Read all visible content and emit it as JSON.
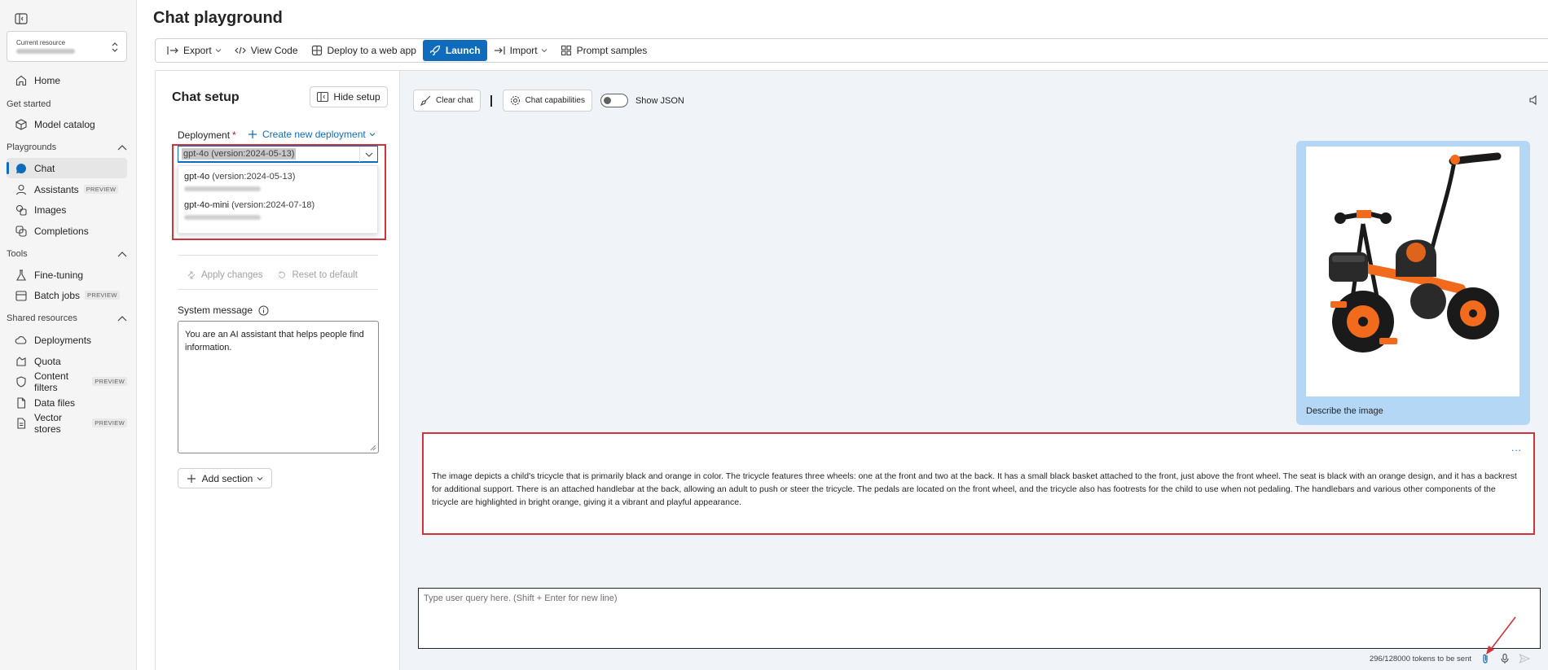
{
  "sidebar": {
    "current_resource_label": "Current resource",
    "items": {
      "home": "Home",
      "get_started_header": "Get started",
      "model_catalog": "Model catalog",
      "playgrounds_header": "Playgrounds",
      "chat": "Chat",
      "assistants": "Assistants",
      "images": "Images",
      "completions": "Completions",
      "tools_header": "Tools",
      "fine_tuning": "Fine-tuning",
      "batch_jobs": "Batch jobs",
      "shared_resources_header": "Shared resources",
      "deployments": "Deployments",
      "quota": "Quota",
      "content_filters": "Content filters",
      "data_files": "Data files",
      "vector_stores": "Vector stores"
    },
    "preview_badge": "PREVIEW"
  },
  "page": {
    "title": "Chat playground"
  },
  "toolbar": {
    "export": "Export",
    "view_code": "View Code",
    "deploy": "Deploy to a web app",
    "launch": "Launch",
    "import": "Import",
    "prompt_samples": "Prompt samples"
  },
  "setup": {
    "title": "Chat setup",
    "hide_setup": "Hide setup",
    "deployment_label": "Deployment",
    "required_mark": "*",
    "create_new_deployment": "Create new deployment",
    "selected_deployment": "gpt-4o (version:2024-05-13)",
    "options": [
      {
        "name": "gpt-4o",
        "version": "(version:2024-05-13)"
      },
      {
        "name": "gpt-4o-mini",
        "version": "(version:2024-07-18)"
      }
    ],
    "apply_changes": "Apply changes",
    "reset_default": "Reset to default",
    "system_message_label": "System message",
    "system_message_value": "You are an AI assistant that helps people find information.",
    "add_section": "Add section"
  },
  "chat": {
    "clear_chat": "Clear chat",
    "chat_capabilities": "Chat capabilities",
    "show_json": "Show JSON",
    "user_message": "Describe the image",
    "assistant_message": "The image depicts a child's tricycle that is primarily black and orange in color. The tricycle features three wheels: one at the front and two at the back. It has a small black basket attached to the front, just above the front wheel. The seat is black with an orange design, and it has a backrest for additional support. There is an attached handlebar at the back, allowing an adult to push or steer the tricycle. The pedals are located on the front wheel, and the tricycle also has footrests for the child to use when not pedaling. The handlebars and various other components of the tricycle are highlighted in bright orange, giving it a vibrant and playful appearance.",
    "more_label": "...",
    "input_placeholder": "Type user query here. (Shift + Enter for new line)",
    "token_count": "296/128000 tokens to be sent"
  },
  "colors": {
    "accent": "#0f6cbd",
    "highlight_red": "#d13438",
    "user_bubble": "#b3d7f5",
    "workspace_bg": "#f0f4f9"
  }
}
